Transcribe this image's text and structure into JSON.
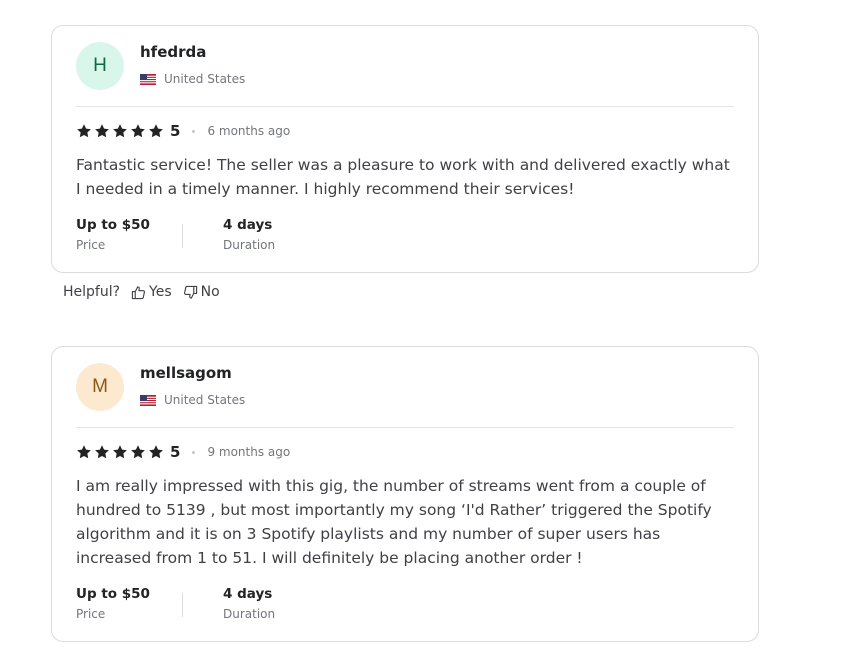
{
  "reviews": [
    {
      "initial": "H",
      "avatar_bg": "#d9f6ea",
      "avatar_fg": "#0c6b3f",
      "username": "hfedrda",
      "country": "United States",
      "rating": "5",
      "time_ago": "6 months ago",
      "text": "Fantastic service! The seller was a pleasure to work with and delivered exactly what I needed in a timely manner. I highly recommend their services!",
      "price_value": "Up to $50",
      "price_label": "Price",
      "duration_value": "4 days",
      "duration_label": "Duration"
    },
    {
      "initial": "M",
      "avatar_bg": "#fde9cf",
      "avatar_fg": "#8a5a15",
      "username": "mellsagom",
      "country": "United States",
      "rating": "5",
      "time_ago": "9 months ago",
      "text": "I am really impressed with this gig, the number of streams went from a couple of hundred to 5139 , but most importantly my song ‘I'd Rather’ triggered the Spotify algorithm and it is on 3 Spotify playlists and my number of super users has increased from 1 to 51. I will definitely be placing another order !",
      "price_value": "Up to $50",
      "price_label": "Price",
      "duration_value": "4 days",
      "duration_label": "Duration"
    }
  ],
  "helpful": {
    "label": "Helpful?",
    "yes": "Yes",
    "no": "No"
  },
  "icons": {
    "star": "star-icon",
    "thumbs_up": "thumbs-up-icon",
    "thumbs_down": "thumbs-down-icon",
    "flag": "us-flag-icon"
  },
  "colors": {
    "star": "#222325",
    "border": "#dadbdd"
  }
}
